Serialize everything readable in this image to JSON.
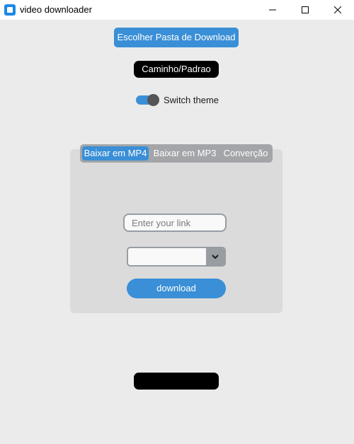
{
  "window": {
    "title": "video downloader",
    "icon": "app-icon"
  },
  "colors": {
    "accent": "#3a8fd6",
    "background": "#ebebeb",
    "frame": "#dbdbdb",
    "tabbar": "#a3a5a8",
    "label_bg": "#000000"
  },
  "header": {
    "folder_button": "Escolher Pasta de Download",
    "path_label": "Caminho/Padrao",
    "theme_switch_label": "Switch theme",
    "theme_switch_on": true
  },
  "tabs": {
    "items": [
      {
        "label": "Baixar em MP4",
        "active": true
      },
      {
        "label": "Baixar em MP3",
        "active": false
      },
      {
        "label": "Converção",
        "active": false
      }
    ]
  },
  "mp4": {
    "link_placeholder": "Enter your link",
    "link_value": "",
    "quality_selected": "",
    "download_label": "download"
  },
  "status": {
    "text": ""
  }
}
